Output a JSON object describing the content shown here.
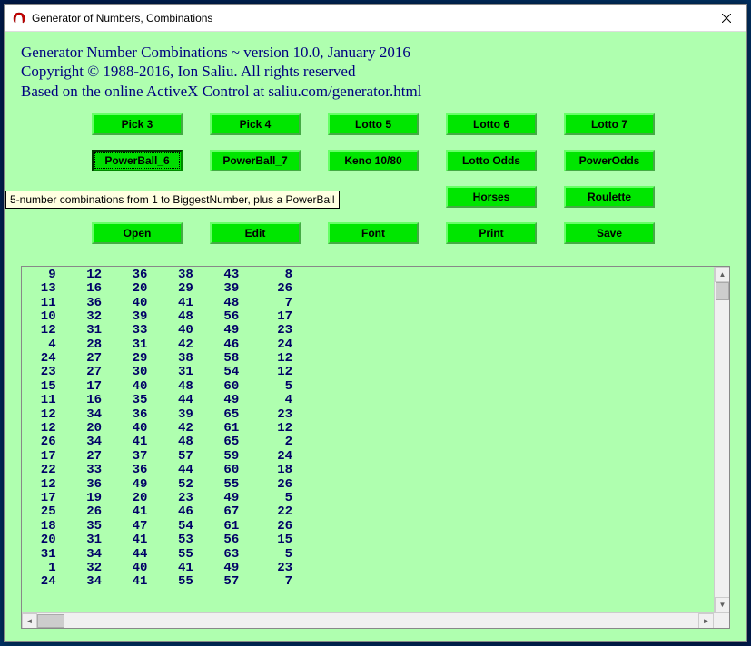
{
  "window": {
    "title": "Generator of Numbers, Combinations"
  },
  "header": {
    "line1": "Generator Number Combinations ~ version 10.0, January 2016",
    "line2": "Copyright © 1988-2016, Ion Saliu. All rights reserved",
    "line3": "Based on the online ActiveX Control at saliu.com/generator.html"
  },
  "buttons": {
    "row1": {
      "b1": "Pick 3",
      "b2": "Pick 4",
      "b3": "Lotto 5",
      "b4": "Lotto 6",
      "b5": "Lotto 7"
    },
    "row2": {
      "b1": "PowerBall_6",
      "b2": "PowerBall_7",
      "b3": "Keno 10/80",
      "b4": "Lotto Odds",
      "b5": "PowerOdds"
    },
    "row3": {
      "b4": "Horses",
      "b5": "Roulette"
    },
    "row4": {
      "b1": "Open",
      "b2": "Edit",
      "b3": "Font",
      "b4": "Print",
      "b5": "Save"
    }
  },
  "tooltip": "5-number combinations from 1 to BiggestNumber, plus a PowerBall",
  "output_rows": [
    [
      9,
      12,
      36,
      38,
      43,
      8
    ],
    [
      13,
      16,
      20,
      29,
      39,
      26
    ],
    [
      11,
      36,
      40,
      41,
      48,
      7
    ],
    [
      10,
      32,
      39,
      48,
      56,
      17
    ],
    [
      12,
      31,
      33,
      40,
      49,
      23
    ],
    [
      4,
      28,
      31,
      42,
      46,
      24
    ],
    [
      24,
      27,
      29,
      38,
      58,
      12
    ],
    [
      23,
      27,
      30,
      31,
      54,
      12
    ],
    [
      15,
      17,
      40,
      48,
      60,
      5
    ],
    [
      11,
      16,
      35,
      44,
      49,
      4
    ],
    [
      12,
      34,
      36,
      39,
      65,
      23
    ],
    [
      12,
      20,
      40,
      42,
      61,
      12
    ],
    [
      26,
      34,
      41,
      48,
      65,
      2
    ],
    [
      17,
      27,
      37,
      57,
      59,
      24
    ],
    [
      22,
      33,
      36,
      44,
      60,
      18
    ],
    [
      12,
      36,
      49,
      52,
      55,
      26
    ],
    [
      17,
      19,
      20,
      23,
      49,
      5
    ],
    [
      25,
      26,
      41,
      46,
      67,
      22
    ],
    [
      18,
      35,
      47,
      54,
      61,
      26
    ],
    [
      20,
      31,
      41,
      53,
      56,
      15
    ],
    [
      31,
      34,
      44,
      55,
      63,
      5
    ],
    [
      1,
      32,
      40,
      41,
      49,
      23
    ],
    [
      24,
      34,
      41,
      55,
      57,
      7
    ]
  ]
}
